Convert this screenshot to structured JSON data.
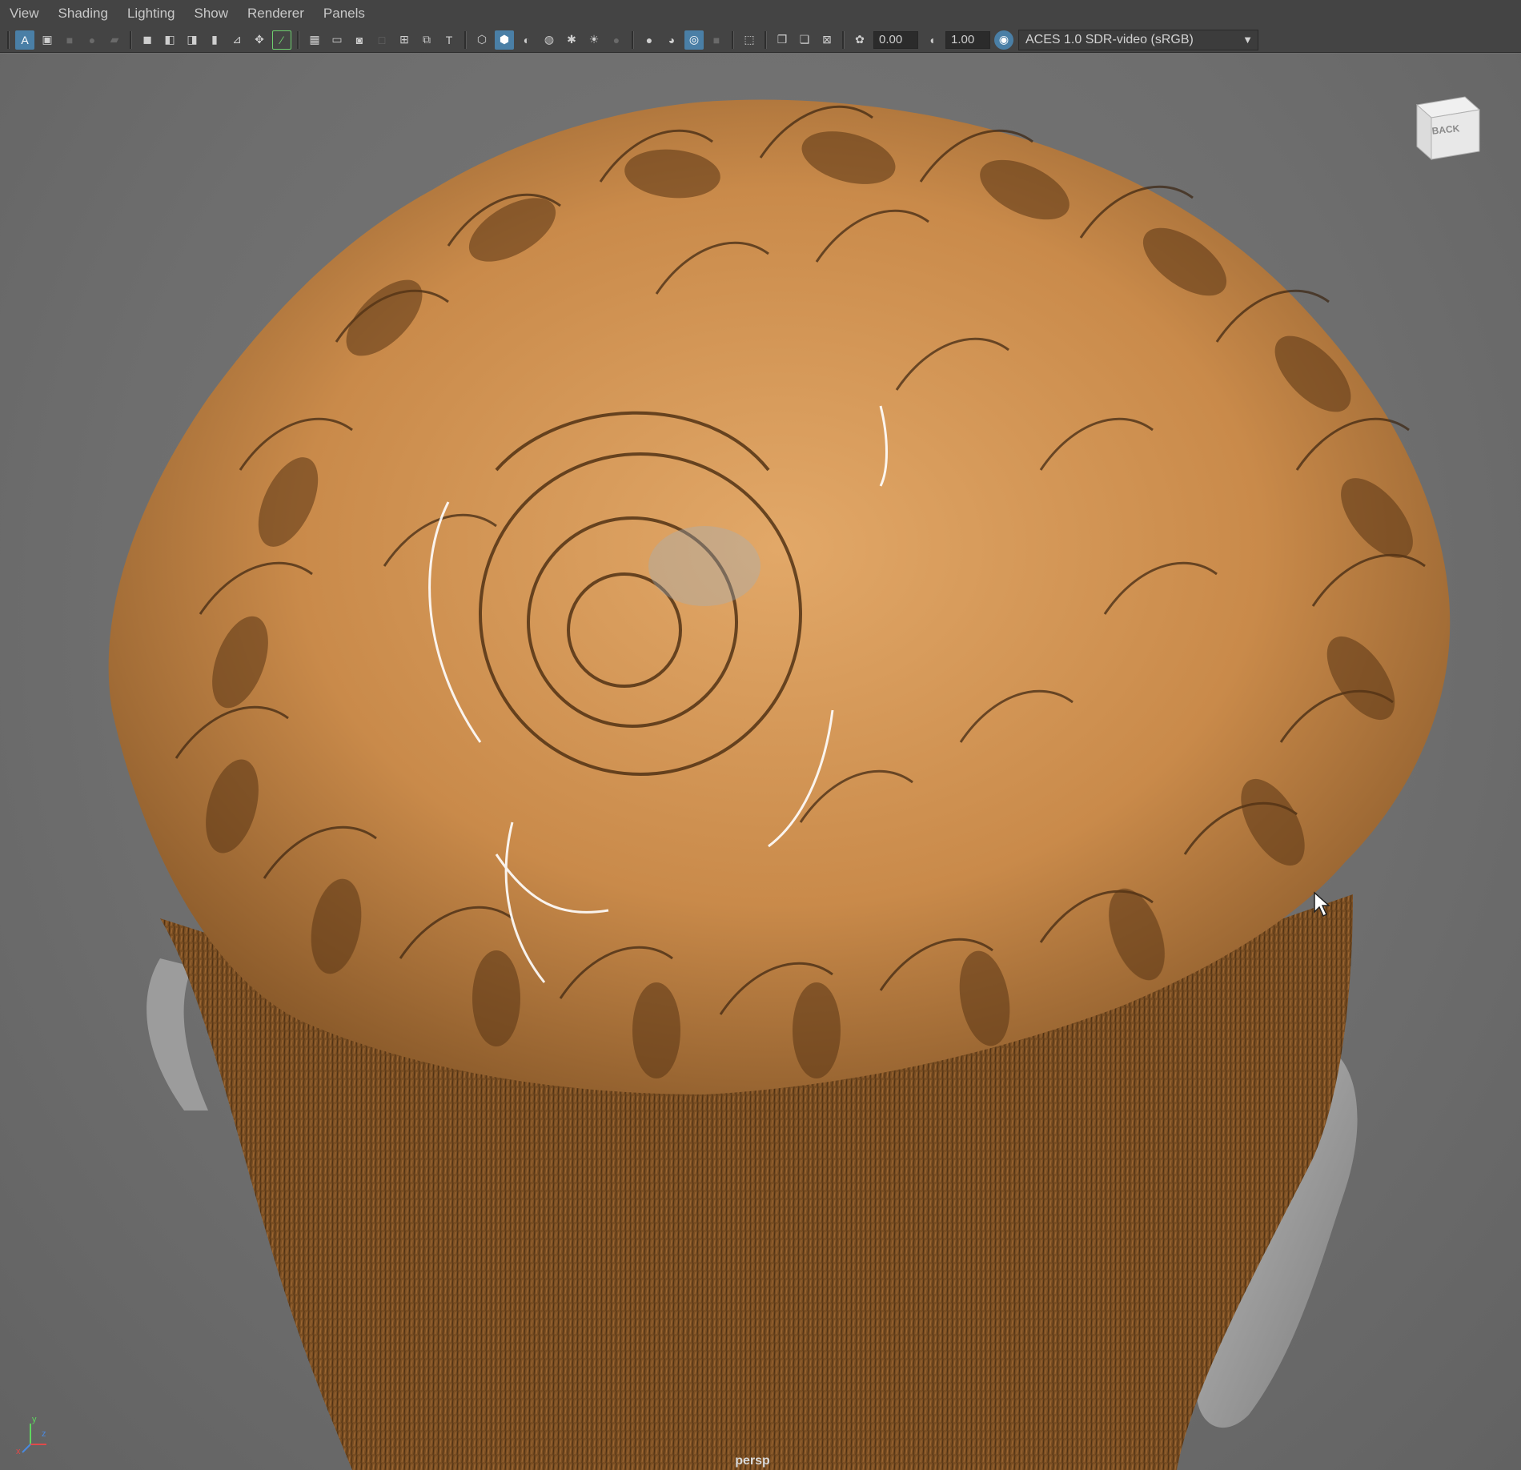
{
  "menu": {
    "items": [
      "View",
      "Shading",
      "Lighting",
      "Show",
      "Renderer",
      "Panels"
    ]
  },
  "toolbar": {
    "exposure_value": "0.00",
    "gamma_value": "1.00",
    "color_space": "ACES 1.0 SDR-video (sRGB)",
    "icons": [
      "select-camera-icon",
      "camera-attributes-icon",
      "bookmark-icon",
      "image-plane-icon",
      "grid-icon",
      "film-gate-icon",
      "resolution-gate-icon",
      "gate-mask-icon",
      "field-chart-icon",
      "safe-action-icon",
      "safe-title-icon",
      "wireframe-icon",
      "smooth-shade-icon",
      "default-material-icon",
      "textured-icon",
      "use-all-lights-icon",
      "shadows-icon",
      "screen-space-ao-icon",
      "motion-blur-icon",
      "anti-aliasing-icon",
      "depth-of-field-icon",
      "isolate-select-icon",
      "xray-icon",
      "xray-joints-icon",
      "xray-active-icon",
      "exposure-icon",
      "gamma-icon",
      "color-management-icon"
    ],
    "accent_color": "#4a7fa6"
  },
  "viewport": {
    "camera_label": "persp",
    "view_cube_face": "BACK",
    "axis_labels": {
      "x": "x",
      "y": "y",
      "z": "z"
    },
    "hair_color": "#c98a4a",
    "background_color": "#6f6f6f"
  }
}
